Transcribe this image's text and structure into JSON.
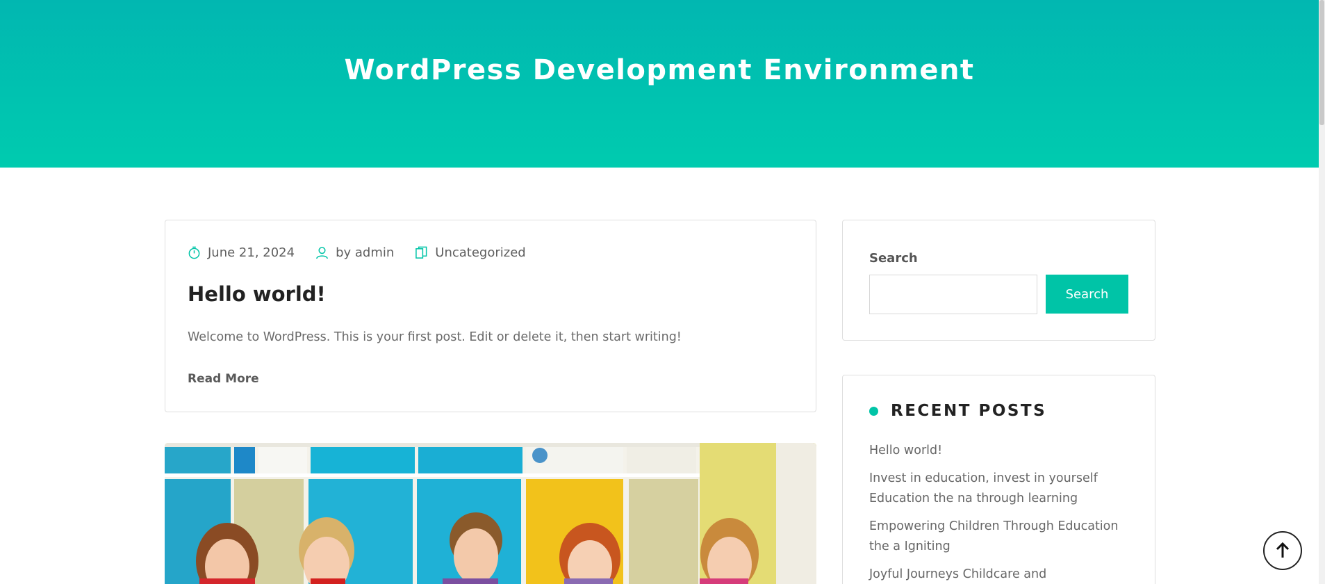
{
  "hero": {
    "title": "WordPress Development Environment"
  },
  "post": {
    "date": "June 21, 2024",
    "author": "by admin",
    "category": "Uncategorized",
    "title": "Hello world!",
    "excerpt": "Welcome to WordPress. This is your first post. Edit or delete it, then start writing!",
    "read_more": "Read More"
  },
  "sidebar": {
    "search": {
      "label": "Search",
      "button_label": "Search",
      "input_value": "",
      "placeholder": ""
    },
    "recent": {
      "title": "RECENT POSTS",
      "items": [
        {
          "label": "Hello world!"
        },
        {
          "label": "Invest in education, invest in yourself Education the na through learning"
        },
        {
          "label": "Empowering Children Through Education the a Igniting"
        },
        {
          "label": "Joyful Journeys Childcare and"
        }
      ]
    }
  },
  "icons": {
    "clock": "clock-icon",
    "user": "user-icon",
    "category": "folder-icon",
    "scroll_top": "arrow-up-icon"
  },
  "colors": {
    "accent": "#00c4a7",
    "hero_top": "#01b7b1",
    "hero_bottom": "#00cbaf"
  }
}
